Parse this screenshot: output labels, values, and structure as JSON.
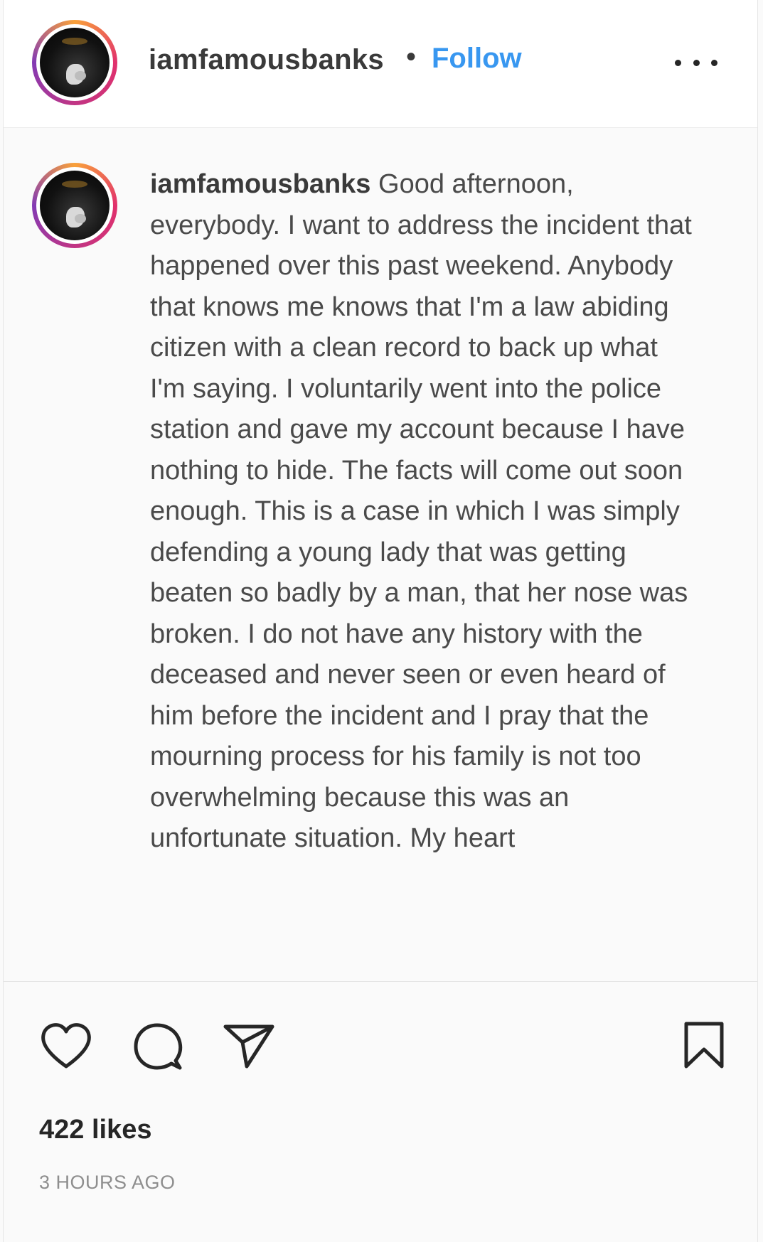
{
  "post": {
    "username": "iamfamousbanks",
    "separator": "•",
    "follow_label": "Follow",
    "more_icon": "more-horizontal-icon",
    "caption": "Good afternoon, everybody. I want to address the incident that happened over this past weekend. Anybody that knows me knows that I'm a law abiding citizen with a clean record to back up what I'm saying. I voluntarily went into the police station and gave my account because I have nothing to hide. The facts will come out soon enough. This is a case in which I was simply defending a young lady that was getting beaten so badly by a man, that her nose was broken. I do not have any history with the deceased and never seen or even heard of him before the incident and I pray that the mourning process for his family is not too overwhelming because this was an unfortunate situation. My heart",
    "likes": "422 likes",
    "timestamp": "3 HOURS AGO"
  },
  "icons": {
    "like": "heart-icon",
    "comment": "comment-icon",
    "share": "paper-plane-icon",
    "save": "bookmark-icon"
  },
  "colors": {
    "follow": "#3897f0",
    "story_ring": "#e1306c",
    "text": "#262626",
    "muted": "#8e8e8e"
  }
}
